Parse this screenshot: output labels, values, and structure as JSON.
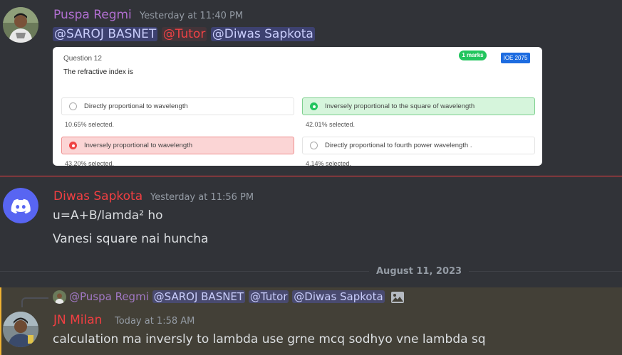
{
  "colors": {
    "background": "#313338",
    "author_purple": "#b16fd1",
    "author_red": "#f23f42",
    "new_divider": "#f23f42",
    "highlight_bg": "#434037",
    "mention_bg": "#3c4270",
    "role_mention_color": "#ed4245"
  },
  "messages": [
    {
      "author": "Puspa Regmi",
      "timestamp": "Yesterday at 11:40 PM",
      "mentions": [
        "@SAROJ BASNET",
        "@Tutor",
        "@Diwas Sapkota"
      ]
    },
    {
      "author": "Diwas Sapkota",
      "timestamp": "Yesterday at 11:56 PM",
      "line1": "u=A+B/lamda² ho",
      "line2": "Vanesi square nai huncha"
    },
    {
      "author": "JN Milan",
      "timestamp": "Today at 1:58 AM",
      "text": "calculation ma inversly to lambda use grne mcq sodhyo vne lambda sq",
      "reply": {
        "author": "@Puspa Regmi",
        "mentions": [
          "@SAROJ BASNET",
          "@Tutor",
          "@Diwas Sapkota"
        ],
        "icon": "image-icon"
      }
    }
  ],
  "quiz": {
    "question_label": "Question 12",
    "question_text": "The refractive index is",
    "marks_badge": "1 marks",
    "year_badge": "IOE 2075",
    "options": [
      {
        "label": "Directly proportional to wavelength",
        "percent": "10.65% selected.",
        "state": "neutral"
      },
      {
        "label": "Inversely proportional to the square of wavelength",
        "percent": "42.01% selected.",
        "state": "correct"
      },
      {
        "label": "Inversely proportional to wavelength",
        "percent": "43.20% selected.",
        "state": "wrong"
      },
      {
        "label": "Directly proportional to fourth power wavelength .",
        "percent": "4.14% selected.",
        "state": "neutral"
      }
    ]
  },
  "date_divider": "August 11, 2023"
}
